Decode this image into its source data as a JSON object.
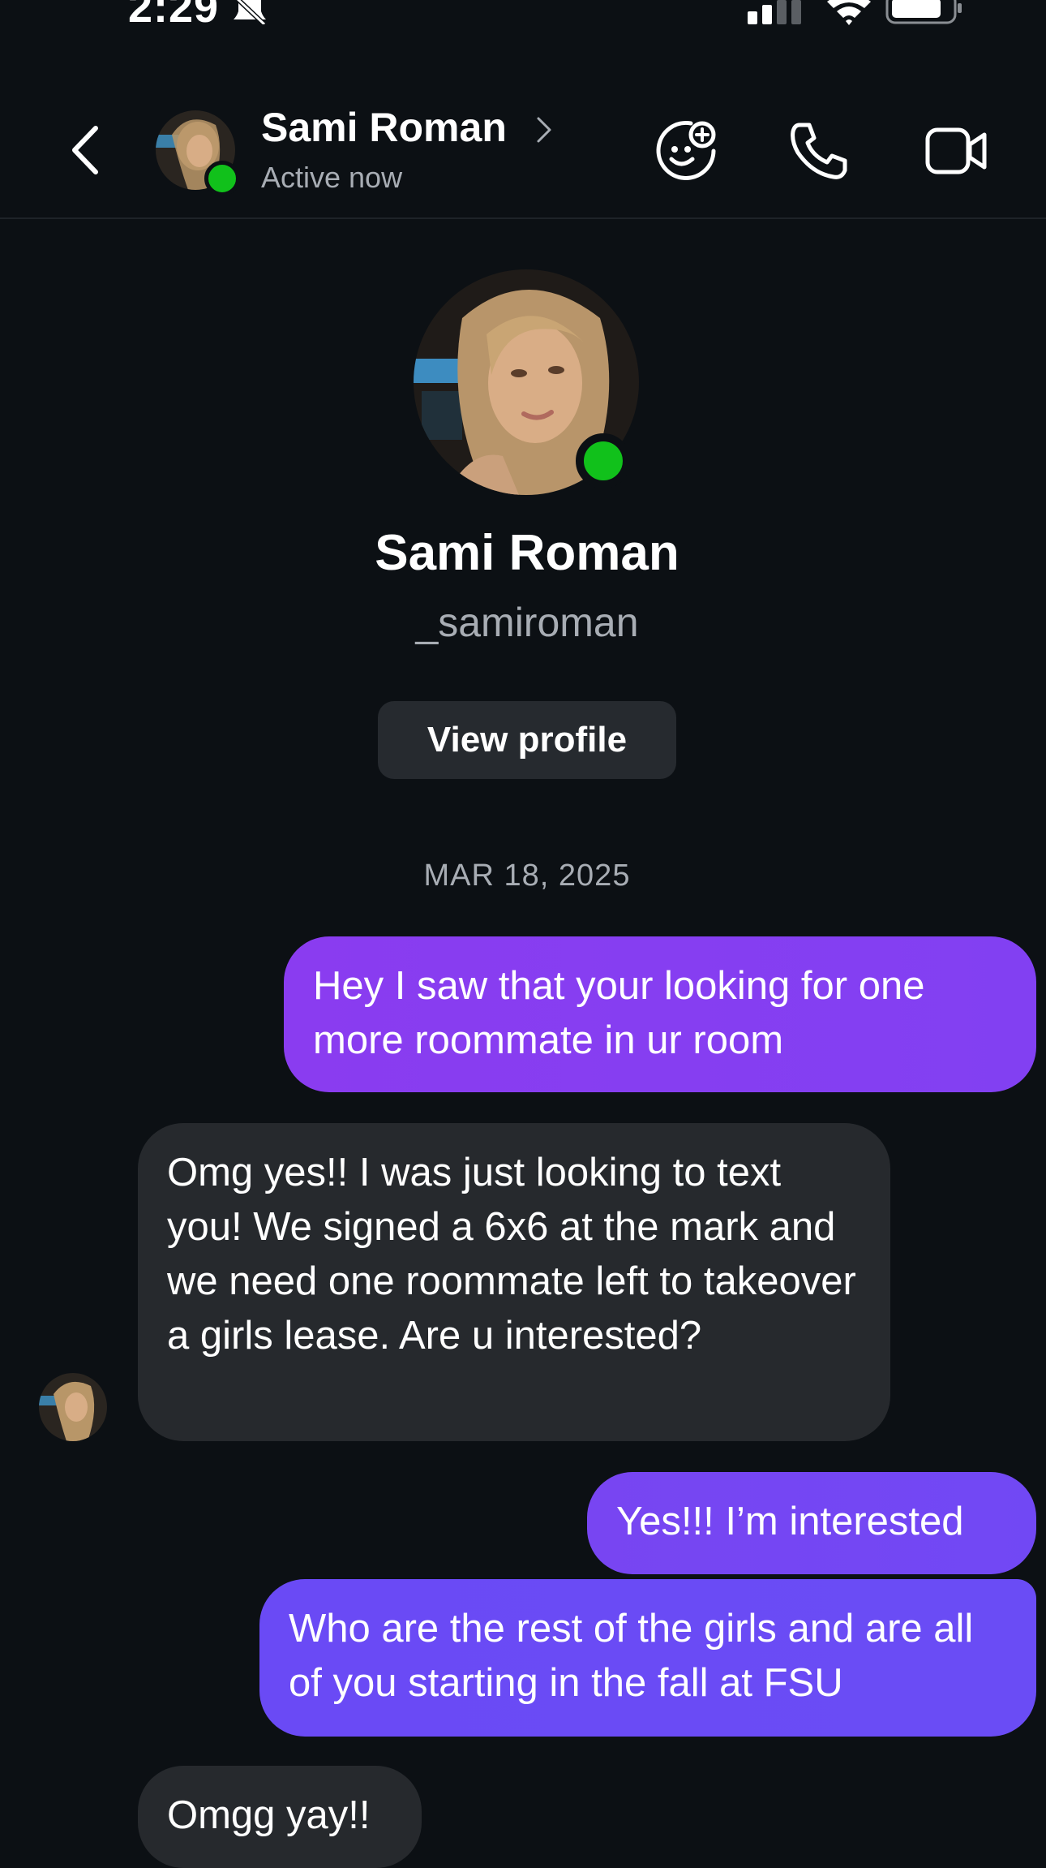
{
  "status_bar": {
    "time": "2:29",
    "icons": [
      "bell-slash-icon",
      "cellular-signal-icon",
      "wifi-icon",
      "battery-icon"
    ]
  },
  "header": {
    "back_icon": "chevron-left-icon",
    "name": "Sami Roman",
    "status": "Active now",
    "actions": [
      "sticker-icon",
      "phone-icon",
      "video-camera-icon"
    ]
  },
  "profile": {
    "name": "Sami Roman",
    "username": "_samiroman",
    "view_profile_label": "View profile"
  },
  "date_separator": "MAR 18, 2025",
  "messages": [
    {
      "direction": "outgoing",
      "text": "Hey I saw that your looking for one more roommate in ur room"
    },
    {
      "direction": "incoming",
      "text": "Omg yes!! I was just looking to text you! We signed a 6x6 at the mark and we need one roommate left to takeover a girls lease. Are u interested?"
    },
    {
      "direction": "outgoing",
      "text": "Yes!!! I’m interested"
    },
    {
      "direction": "outgoing",
      "text": "Who are the rest of the girls and are all of you starting in the fall at FSU"
    },
    {
      "direction": "incoming",
      "text": "Omgg yay!!"
    }
  ],
  "colors": {
    "background": "#0c1014",
    "incoming_bubble": "#26292d",
    "outgoing_bubble_start": "#8a3cf0",
    "outgoing_bubble_end": "#6a4cf5",
    "online": "#11c11b"
  }
}
